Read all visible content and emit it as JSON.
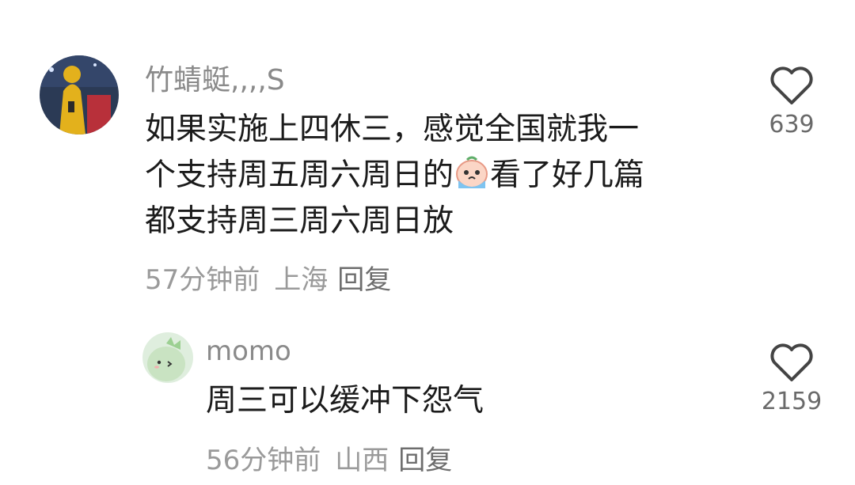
{
  "comments": [
    {
      "username": "竹蜻蜓,,,,S",
      "text_lines": [
        "如果实施上四休三，感觉全国就我一",
        "个支持周五周六周日的",
        "看了好几篇",
        "都支持周三周六周日放"
      ],
      "emoji_icon": "crying-emoji-icon",
      "time": "57分钟前",
      "location": "上海",
      "reply_label": "回复",
      "likes": "639",
      "avatar_icon": "person-yellow-raincoat-avatar"
    },
    {
      "username": "momo",
      "text_lines": [
        "周三可以缓冲下怨气"
      ],
      "time": "56分钟前",
      "location": "山西",
      "reply_label": "回复",
      "likes": "2159",
      "avatar_icon": "green-dinosaur-avatar"
    }
  ],
  "colors": {
    "username": "#8a8a8a",
    "meta": "#9a9a9a",
    "text": "#1b1b1b"
  }
}
